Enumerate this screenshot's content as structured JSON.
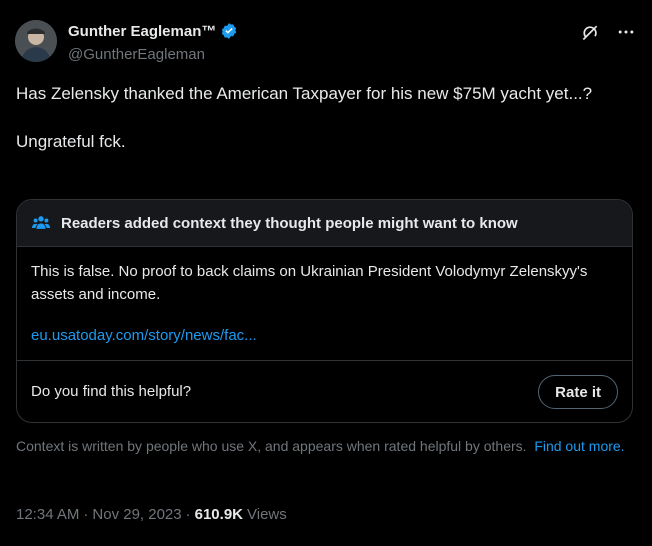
{
  "author": {
    "display_name": "Gunther Eagleman™",
    "handle": "@GuntherEagleman",
    "verified": true
  },
  "tweet": {
    "text": "Has Zelensky thanked the American Taxpayer for his new $75M yacht yet...?\n\nUngrateful fck."
  },
  "note": {
    "title": "Readers added context they thought people might want to know",
    "body": "This is false. No proof to back claims on Ukrainian President Volodymyr Zelenskyy's assets and income.",
    "link": "eu.usatoday.com/story/news/fac...",
    "helpful_question": "Do you find this helpful?",
    "rate_label": "Rate it"
  },
  "context": {
    "text": "Context is written by people who use X, and appears when rated helpful by others.",
    "link": "Find out more."
  },
  "meta": {
    "time": "12:34 AM",
    "date": "Nov 29, 2023",
    "views_count": "610.9K",
    "views_label": "Views"
  },
  "colors": {
    "accent": "#1d9bf0",
    "secondary_text": "#71767b",
    "border": "#2f3336"
  },
  "icons": [
    "verified-badge-icon",
    "grok-icon",
    "more-icon",
    "people-icon"
  ]
}
